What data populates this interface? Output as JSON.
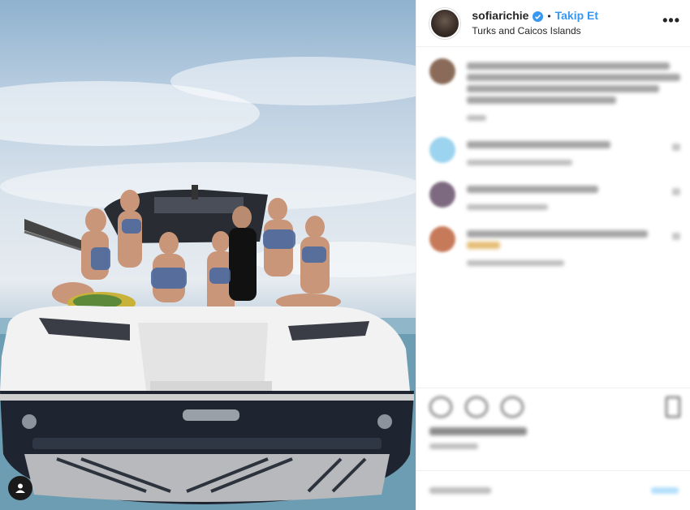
{
  "post": {
    "username": "sofiarichie",
    "separator": "•",
    "follow_label": "Takip Et",
    "location": "Turks and Caicos Islands",
    "more_label": "•••"
  },
  "icons": {
    "verified": "verified-badge-icon",
    "more": "more-options-icon",
    "user_tag": "user-tag-icon"
  },
  "colors": {
    "accent": "#3897f0",
    "text": "#262626",
    "border": "#efefef"
  },
  "comments": [
    {
      "avatar_color": "#8a6a58"
    },
    {
      "avatar_color": "#9cd3ee"
    },
    {
      "avatar_color": "#7e6a80"
    },
    {
      "avatar_color": "#c77a5a"
    }
  ]
}
